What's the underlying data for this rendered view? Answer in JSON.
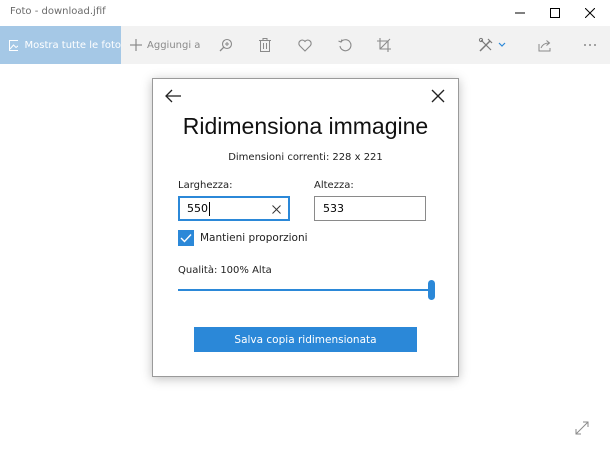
{
  "window": {
    "title": "Foto - download.jfif",
    "controls": [
      "minimize",
      "maximize",
      "close"
    ]
  },
  "toolbar": {
    "show_all_label": "Mostra tutte le foto",
    "add_label": "Aggiungi a",
    "icons": [
      "pictures-icon",
      "plus-icon",
      "zoom-icon",
      "trash-icon",
      "heart-icon",
      "rotate-icon",
      "crop-icon",
      "edit-icon",
      "chevron-down-icon",
      "share-icon",
      "more-icon"
    ]
  },
  "dialog": {
    "title": "Ridimensiona immagine",
    "current_dimensions_label": "Dimensioni correnti:",
    "current_dimensions_value": "228 x 221",
    "width_label": "Larghezza:",
    "width_value": "550",
    "height_label": "Altezza:",
    "height_value": "533",
    "keep_ratio_label": "Mantieni proporzioni",
    "keep_ratio_checked": true,
    "quality_label": "Qualità:",
    "quality_value": "100% Alta",
    "quality_percent": 100,
    "save_label": "Salva copia ridimensionata"
  },
  "colors": {
    "accent": "#2b88d8",
    "toolbar_bg": "#f2f2f2",
    "primary_tab_bg": "#a5c8e6"
  }
}
